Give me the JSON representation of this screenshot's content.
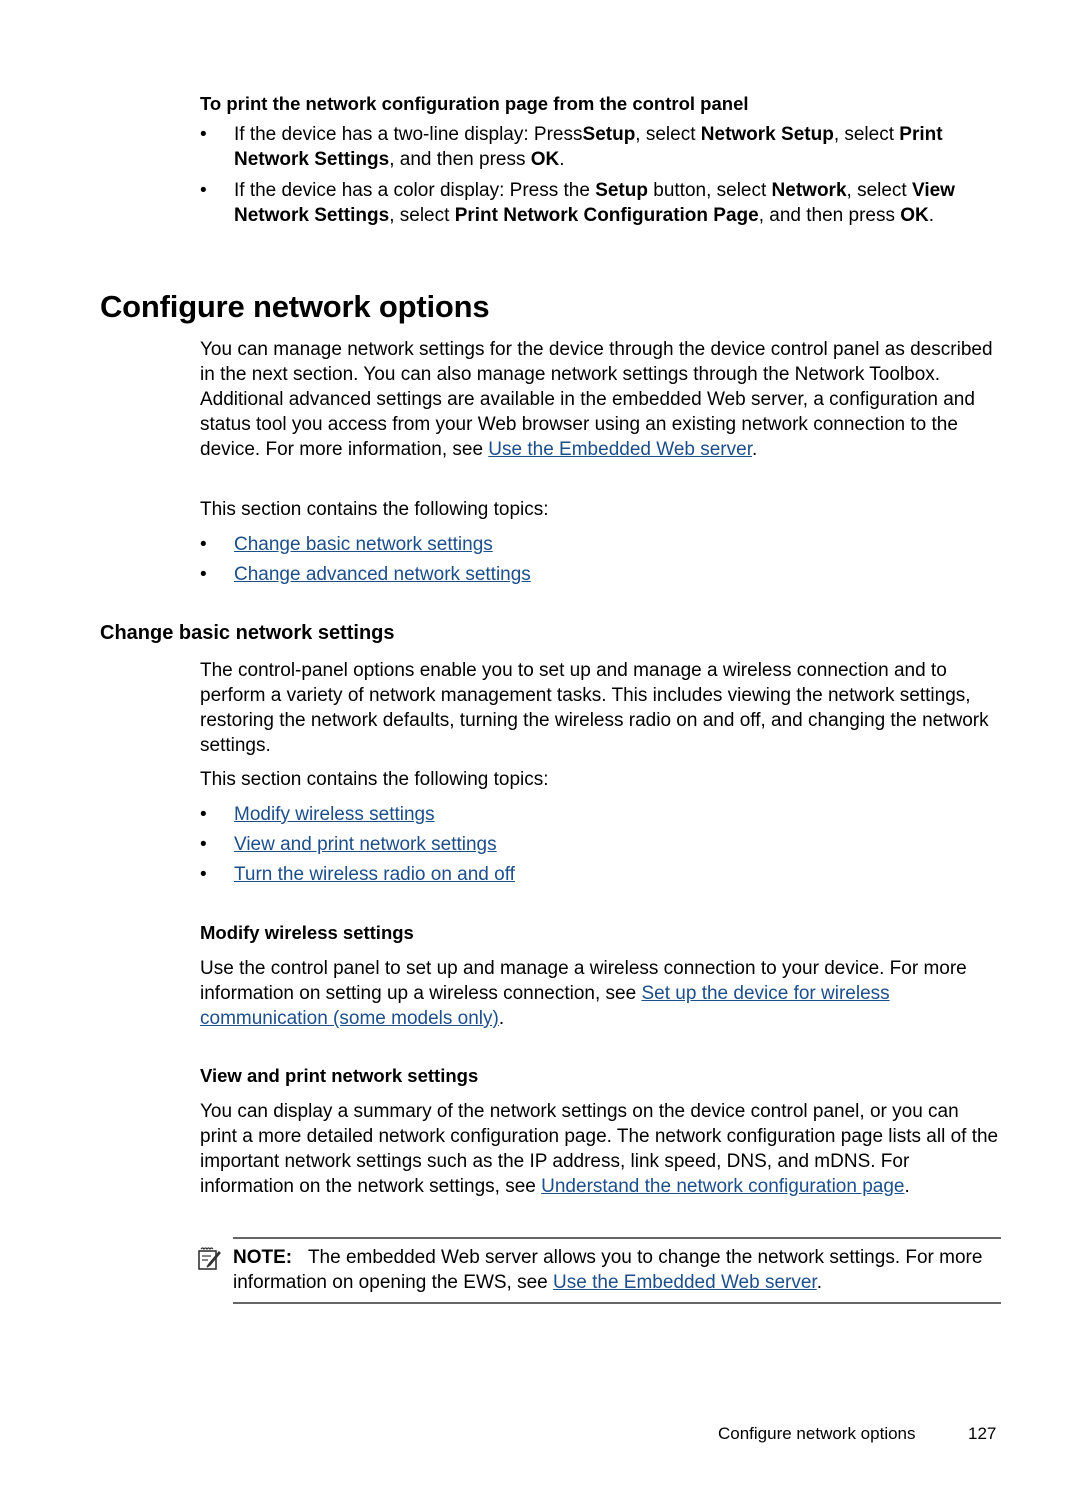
{
  "proc_heading": "To print the network configuration page from the control panel",
  "proc_items": [
    {
      "parts": [
        {
          "t": "If the device has a two-line display: Press",
          "b": false
        },
        {
          "t": "Setup",
          "b": true
        },
        {
          "t": ", select ",
          "b": false
        },
        {
          "t": "Network Setup",
          "b": true
        },
        {
          "t": ", select ",
          "b": false
        },
        {
          "t": "Print Network Settings",
          "b": true
        },
        {
          "t": ", and then press ",
          "b": false
        },
        {
          "t": "OK",
          "b": true
        },
        {
          "t": ".",
          "b": false
        }
      ]
    },
    {
      "parts": [
        {
          "t": "If the device has a color display: Press the ",
          "b": false
        },
        {
          "t": "Setup",
          "b": true
        },
        {
          "t": " button, select ",
          "b": false
        },
        {
          "t": "Network",
          "b": true
        },
        {
          "t": ", select ",
          "b": false
        },
        {
          "t": "View Network Settings",
          "b": true
        },
        {
          "t": ", select ",
          "b": false
        },
        {
          "t": "Print Network Configuration Page",
          "b": true
        },
        {
          "t": ", and then press ",
          "b": false
        },
        {
          "t": "OK",
          "b": true
        },
        {
          "t": ".",
          "b": false
        }
      ]
    }
  ],
  "bullet_char": "•",
  "section_title": "Configure network options",
  "section_intro": "You can manage network settings for the device through the device control panel as described in the next section. You can also manage network settings through the Network Toolbox. Additional advanced settings are available in the embedded Web server, a configuration and status tool you access from your Web browser using an existing network connection to the device. For more information, see ",
  "section_intro_link": "Use the Embedded Web server",
  "period": ".",
  "topics_intro": "This section contains the following topics:",
  "section_topics": [
    "Change basic network settings",
    "Change advanced network settings"
  ],
  "subsection_title": "Change basic network settings",
  "subsection_intro": "The control-panel options enable you to set up and manage a wireless connection and to perform a variety of network management tasks. This includes viewing the network settings, restoring the network defaults, turning the wireless radio on and off, and changing the network settings.",
  "subsection_topics": [
    "Modify wireless settings",
    "View and print network settings",
    "Turn the wireless radio on and off"
  ],
  "modify_heading": "Modify wireless settings",
  "modify_text": "Use the control panel to set up and manage a wireless connection to your device. For more information on setting up a wireless connection, see ",
  "modify_link": "Set up the device for wireless communication (some models only)",
  "view_heading": "View and print network settings",
  "view_text": "You can display a summary of the network settings on the device control panel, or you can print a more detailed network configuration page. The network configuration page lists all of the important network settings such as the IP address, link speed, DNS, and mDNS. For information on the network settings, see ",
  "view_link": "Understand the network configuration page",
  "note_label": "NOTE:",
  "note_text": "The embedded Web server allows you to change the network settings. For more information on opening the EWS, see ",
  "note_link": "Use the Embedded Web server",
  "footer": {
    "section": "Configure network options",
    "page": "127"
  }
}
